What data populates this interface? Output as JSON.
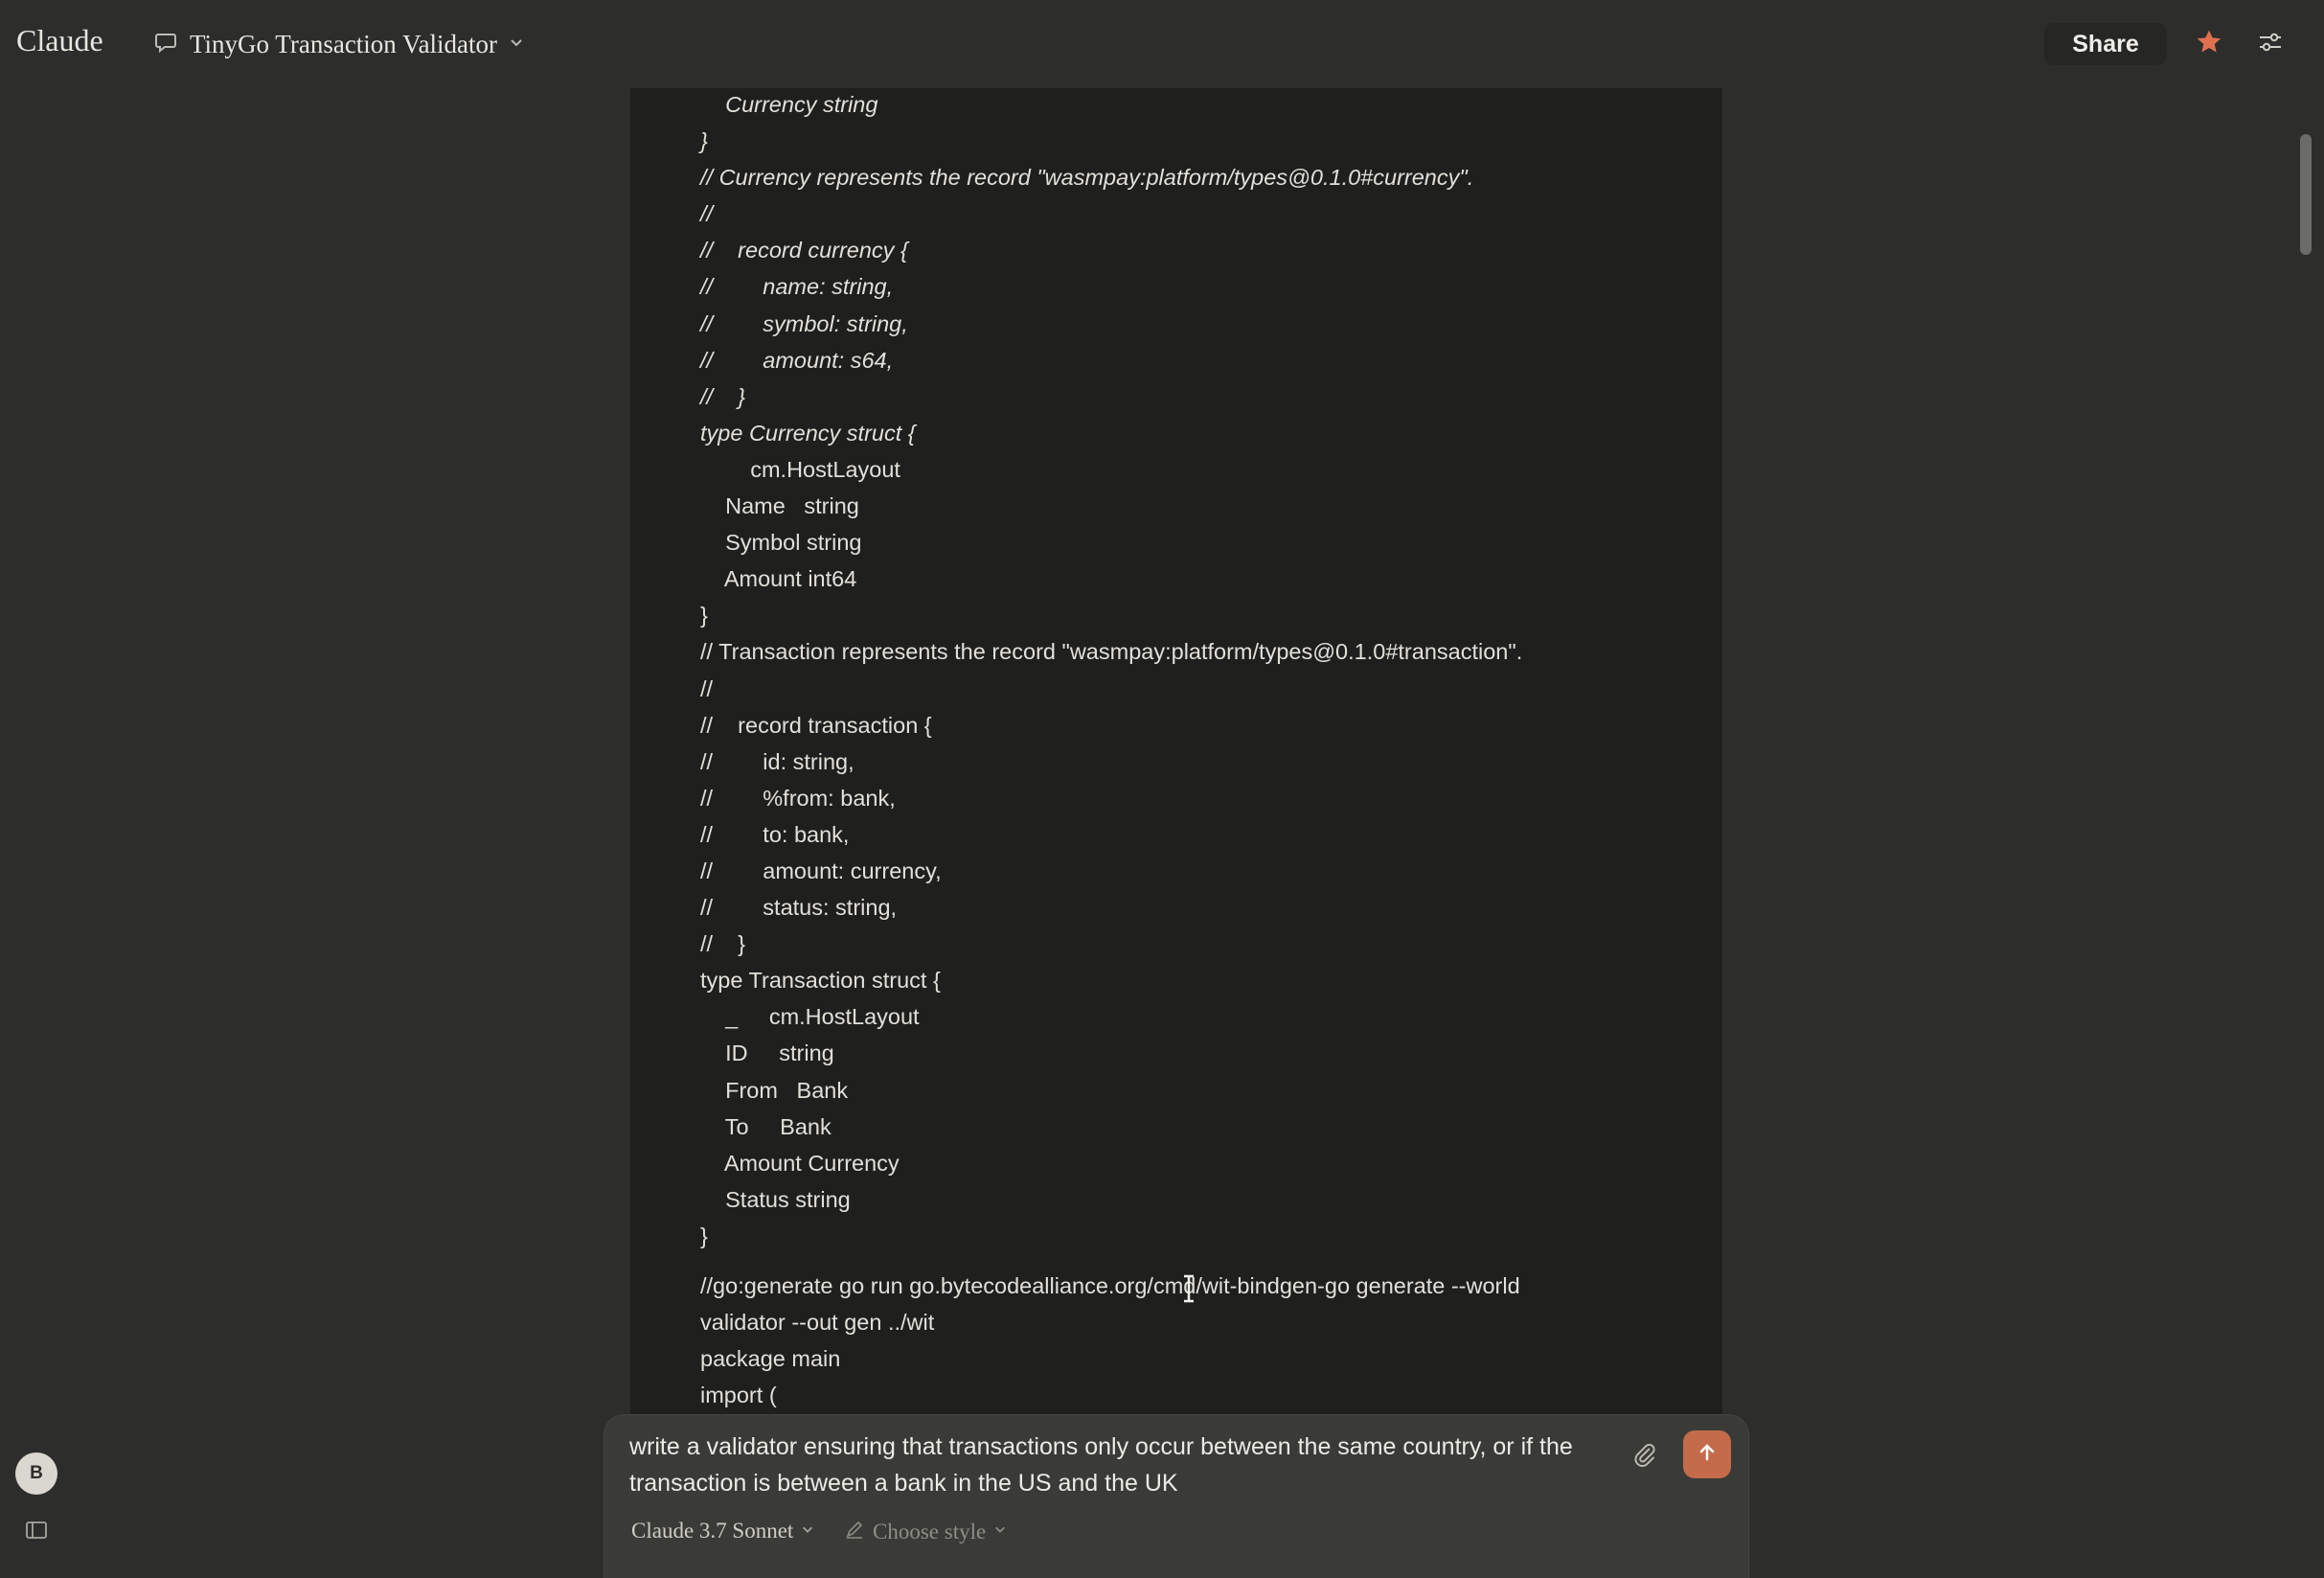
{
  "header": {
    "brand": "Claude",
    "chat_title": "TinyGo Transaction Validator",
    "share_label": "Share",
    "icons": {
      "chat": "chat-bubble-icon",
      "chevron": "chevron-down-icon",
      "star": "star-icon",
      "settings": "sliders-icon"
    },
    "star_color": "#e0704f"
  },
  "code": {
    "lines": [
      {
        "text": "    Currency string",
        "italic": true
      },
      {
        "text": "}",
        "italic": true
      },
      {
        "text": "// Currency represents the record \"wasmpay:platform/types@0.1.0#currency\".",
        "italic": true
      },
      {
        "text": "//",
        "italic": true
      },
      {
        "text": "//    record currency {",
        "italic": true
      },
      {
        "text": "//        name: string,",
        "italic": true
      },
      {
        "text": "//        symbol: string,",
        "italic": true
      },
      {
        "text": "//        amount: s64,",
        "italic": true
      },
      {
        "text": "//    }",
        "italic": true
      },
      {
        "text": "type Currency struct {",
        "italic": true
      },
      {
        "text": "        cm.HostLayout",
        "italic": false
      },
      {
        "text": "    Name   string",
        "italic": false
      },
      {
        "text": "    Symbol string",
        "italic": false
      },
      {
        "text": "    Amount int64",
        "italic": false
      },
      {
        "text": "}",
        "italic": false
      },
      {
        "text": "// Transaction represents the record \"wasmpay:platform/types@0.1.0#transaction\".",
        "italic": false
      },
      {
        "text": "//",
        "italic": false
      },
      {
        "text": "//    record transaction {",
        "italic": false
      },
      {
        "text": "//        id: string,",
        "italic": false
      },
      {
        "text": "//        %from: bank,",
        "italic": false
      },
      {
        "text": "//        to: bank,",
        "italic": false
      },
      {
        "text": "//        amount: currency,",
        "italic": false
      },
      {
        "text": "//        status: string,",
        "italic": false
      },
      {
        "text": "//    }",
        "italic": false
      },
      {
        "text": "type Transaction struct {",
        "italic": false
      },
      {
        "text": "    _     cm.HostLayout",
        "italic": false
      },
      {
        "text": "    ID     string",
        "italic": false
      },
      {
        "text": "    From   Bank",
        "italic": false
      },
      {
        "text": "    To     Bank",
        "italic": false
      },
      {
        "text": "    Amount Currency",
        "italic": false
      },
      {
        "text": "    Status string",
        "italic": false
      },
      {
        "text": "}",
        "italic": false
      },
      {
        "text": "//go:generate go run go.bytecodealliance.org/cmd/wit-bindgen-go generate --world",
        "italic": false,
        "gap": true
      },
      {
        "text": "validator --out gen ../wit",
        "italic": false
      },
      {
        "text": "package main",
        "italic": false
      },
      {
        "text": "import (",
        "italic": false
      }
    ]
  },
  "composer": {
    "message": "write a validator ensuring that transactions only occur between the same country, or if the transaction is between a bank in the US and the UK",
    "attach_icon": "paperclip-icon",
    "send_icon": "arrow-up-icon",
    "send_color": "#c46b4b",
    "model_label": "Claude 3.7 Sonnet",
    "style_label": "Choose style"
  },
  "sidebar": {
    "avatar_initial": "B",
    "toggle_icon": "sidebar-toggle-icon"
  }
}
